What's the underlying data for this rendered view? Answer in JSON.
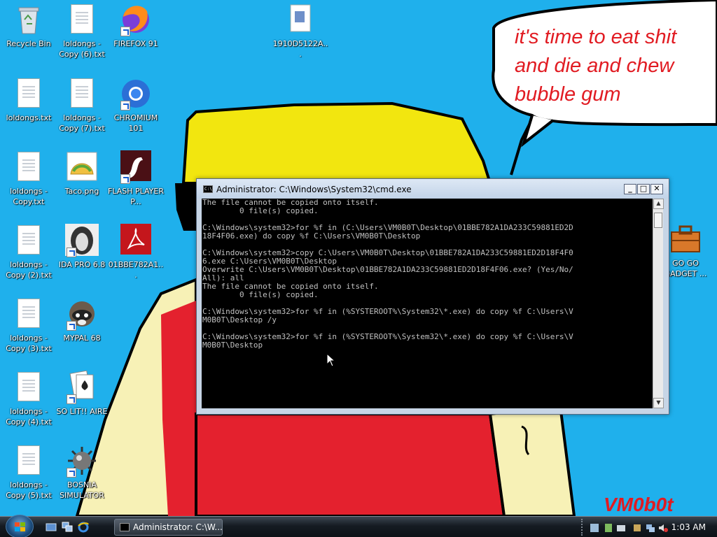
{
  "wallpaper": {
    "speech_text_lines": [
      "it's time to eat shit",
      "and die and chew",
      "bubble gum"
    ],
    "signature": "VM0b0t"
  },
  "desktop_icons": [
    {
      "label": "Recycle Bin",
      "icon": "recycle-bin-icon"
    },
    {
      "label": "loldongs - Copy (6).txt",
      "icon": "text-file-icon"
    },
    {
      "label": "FIREFOX 91",
      "icon": "firefox-icon"
    },
    {
      "label": "1910D5122A...",
      "icon": "file-icon"
    },
    {
      "label": "loldongs.txt",
      "icon": "text-file-icon"
    },
    {
      "label": "loldongs - Copy (7).txt",
      "icon": "text-file-icon"
    },
    {
      "label": "CHROMIUM 101",
      "icon": "chromium-icon"
    },
    {
      "label": "loldongs - Copy.txt",
      "icon": "text-file-icon"
    },
    {
      "label": "Taco.png",
      "icon": "taco-image-icon"
    },
    {
      "label": "FLASH PLAYER P...",
      "icon": "flash-player-icon"
    },
    {
      "label": "loldongs - Copy (2).txt",
      "icon": "text-file-icon"
    },
    {
      "label": "IDA PRO 6.8",
      "icon": "ida-pro-icon"
    },
    {
      "label": "01BBE782A1...",
      "icon": "pdf-icon"
    },
    {
      "label": "loldongs - Copy (3).txt",
      "icon": "text-file-icon"
    },
    {
      "label": "MYPAL 68",
      "icon": "mypal-icon"
    },
    {
      "label": "loldongs - Copy (4).txt",
      "icon": "text-file-icon"
    },
    {
      "label": "SO LIT!! AIRE",
      "icon": "solitaire-icon"
    },
    {
      "label": "loldongs - Copy (5).txt",
      "icon": "text-file-icon"
    },
    {
      "label": "BOSNIA SIMULATOR",
      "icon": "minesweeper-icon"
    },
    {
      "label": "GO GO GADGET ...",
      "icon": "toolbox-icon"
    }
  ],
  "cmd_window": {
    "title": "Administrator: C:\\Windows\\System32\\cmd.exe",
    "buttons": {
      "minimize": "_",
      "maximize": "□",
      "close": "✕"
    },
    "console_text": "The file cannot be copied onto itself.\n        0 file(s) copied.\n\nC:\\Windows\\system32>for %f in (C:\\Users\\VM0B0T\\Desktop\\01BBE782A1DA233C59881ED2D\n18F4F06.exe) do copy %f C:\\Users\\VM0B0T\\Desktop\n\nC:\\Windows\\system32>copy C:\\Users\\VM0B0T\\Desktop\\01BBE782A1DA233C59881ED2D18F4F0\n6.exe C:\\Users\\VM0B0T\\Desktop\nOverwrite C:\\Users\\VM0B0T\\Desktop\\01BBE782A1DA233C59881ED2D18F4F06.exe? (Yes/No/\nAll): all\nThe file cannot be copied onto itself.\n        0 file(s) copied.\n\nC:\\Windows\\system32>for %f in (%SYSTEROOT%\\System32\\*.exe) do copy %f C:\\Users\\V\nM0B0T\\Desktop /y\n\nC:\\Windows\\system32>for %f in (%SYSTEROOT%\\System32\\*.exe) do copy %f C:\\Users\\V\nM0B0T\\Desktop"
  },
  "taskbar": {
    "task_button_label": "Administrator: C:\\W...",
    "clock": "1:03 AM"
  }
}
